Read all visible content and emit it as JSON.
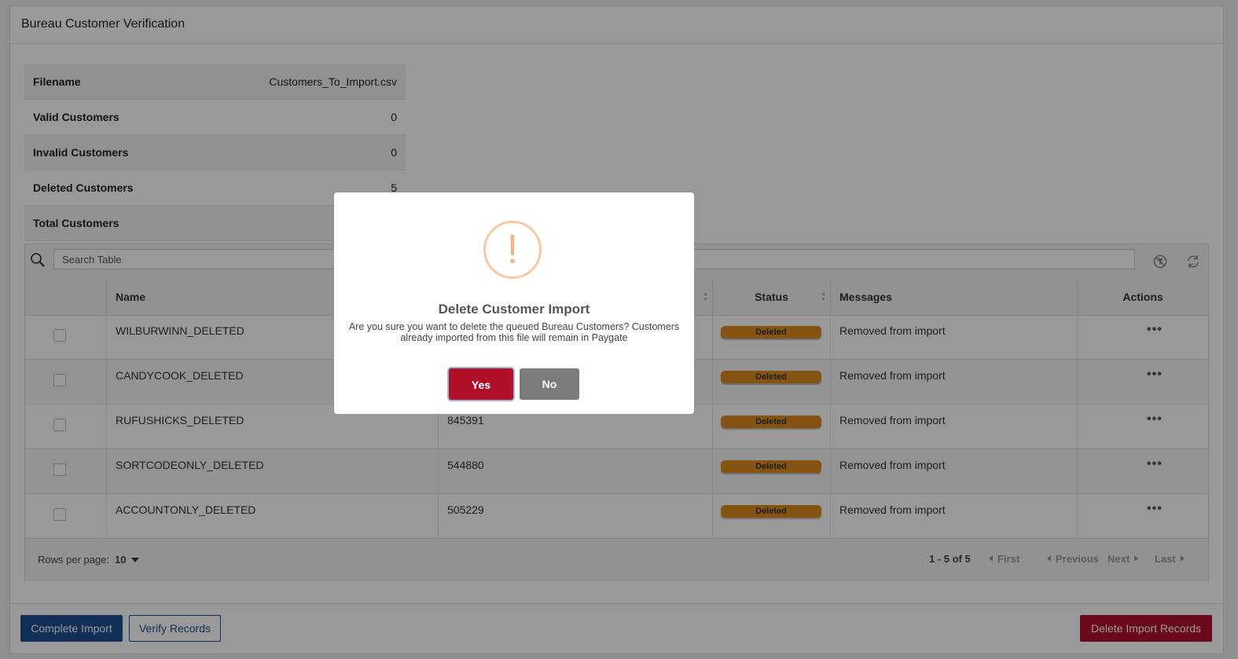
{
  "page": {
    "title": "Bureau Customer Verification"
  },
  "summary": [
    {
      "label": "Filename",
      "value": "Customers_To_Import.csv"
    },
    {
      "label": "Valid Customers",
      "value": "0"
    },
    {
      "label": "Invalid Customers",
      "value": "0"
    },
    {
      "label": "Deleted Customers",
      "value": "5"
    },
    {
      "label": "Total Customers",
      "value": ""
    }
  ],
  "table": {
    "search_placeholder": "Search Table",
    "icons": {
      "search": "search-icon",
      "clear_filter": "clear-filter-icon",
      "refresh": "refresh-icon",
      "actions": "more-horizontal-icon"
    },
    "columns": {
      "name": "Name",
      "ref": "",
      "status": "Status",
      "messages": "Messages",
      "actions": "Actions"
    },
    "rows": [
      {
        "name": "WILBURWINN_DELETED",
        "ref": "",
        "status": "Deleted",
        "message": "Removed from import",
        "actions": "•••"
      },
      {
        "name": "CANDYCOOK_DELETED",
        "ref": "",
        "status": "Deleted",
        "message": "Removed from import",
        "actions": "•••"
      },
      {
        "name": "RUFUSHICKS_DELETED",
        "ref": "845391",
        "status": "Deleted",
        "message": "Removed from import",
        "actions": "•••"
      },
      {
        "name": "SORTCODEONLY_DELETED",
        "ref": "544880",
        "status": "Deleted",
        "message": "Removed from import",
        "actions": "•••"
      },
      {
        "name": "ACCOUNTONLY_DELETED",
        "ref": "505229",
        "status": "Deleted",
        "message": "Removed from import",
        "actions": "•••"
      }
    ],
    "footer": {
      "rows_per_page_label": "Rows per page:",
      "rows_per_page_value": "10",
      "page_info": "1 - 5 of 5",
      "first": "First",
      "previous": "Previous",
      "next": "Next",
      "last": "Last"
    }
  },
  "buttons": {
    "complete_import": "Complete Import",
    "verify_records": "Verify Records",
    "delete_import_records": "Delete Import Records"
  },
  "modal": {
    "icon": "warning-exclamation-icon",
    "icon_glyph": "!",
    "title": "Delete Customer Import",
    "text": "Are you sure you want to delete the queued Bureau Customers? Customers already imported from this file will remain in Paygate",
    "yes": "Yes",
    "no": "No"
  },
  "colors": {
    "primary": "#1d4f91",
    "danger": "#b1102a",
    "status_deleted": "#e08a1f",
    "warning_icon": "#f3b583",
    "no_button": "#7b7b7b"
  }
}
